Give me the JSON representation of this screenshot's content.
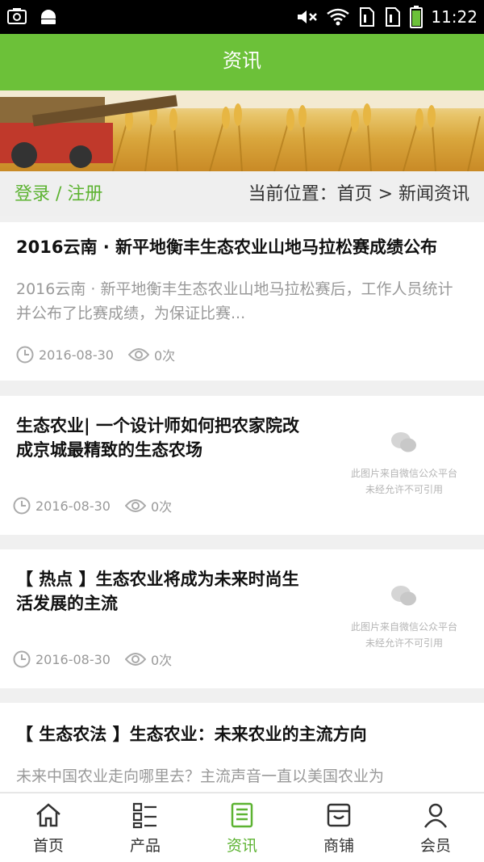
{
  "status_bar": {
    "time": "11:22",
    "icons": [
      "screenshot-icon",
      "android-icon",
      "mute-icon",
      "wifi-icon",
      "sim1-icon",
      "sim2-icon",
      "battery-icon"
    ]
  },
  "header": {
    "title": "资讯"
  },
  "breadcrumb": {
    "login_register": "登录 / 注册",
    "location": "当前位置：首页 > 新闻资讯"
  },
  "articles": [
    {
      "title": "2016云南 · 新平地衡丰生态农业山地马拉松赛成绩公布",
      "summary": "2016云南 · 新平地衡丰生态农业山地马拉松赛后，工作人员统计并公布了比赛成绩，为保证比赛...",
      "date": "2016-08-30",
      "views": "0次"
    },
    {
      "title": "生态农业| 一个设计师如何把农家院改成京城最精致的生态农场",
      "date": "2016-08-30",
      "views": "0次",
      "thumb_line1": "此图片来自微信公众平台",
      "thumb_line2": "未经允许不可引用"
    },
    {
      "title": "【 热点 】生态农业将成为未来时尚生活发展的主流",
      "date": "2016-08-30",
      "views": "0次",
      "thumb_line1": "此图片来自微信公众平台",
      "thumb_line2": "未经允许不可引用"
    },
    {
      "title": "【 生态农法 】生态农业：未来农业的主流方向",
      "summary": "未来中国农业走向哪里去？主流声音一直以美国农业为"
    }
  ],
  "bottom_nav": [
    {
      "label": "首页",
      "icon": "home-icon"
    },
    {
      "label": "产品",
      "icon": "list-icon"
    },
    {
      "label": "资讯",
      "icon": "news-icon",
      "active": true
    },
    {
      "label": "商铺",
      "icon": "store-icon"
    },
    {
      "label": "会员",
      "icon": "user-icon"
    }
  ],
  "colors": {
    "accent": "#6cc139",
    "accent_text": "#5db332"
  }
}
